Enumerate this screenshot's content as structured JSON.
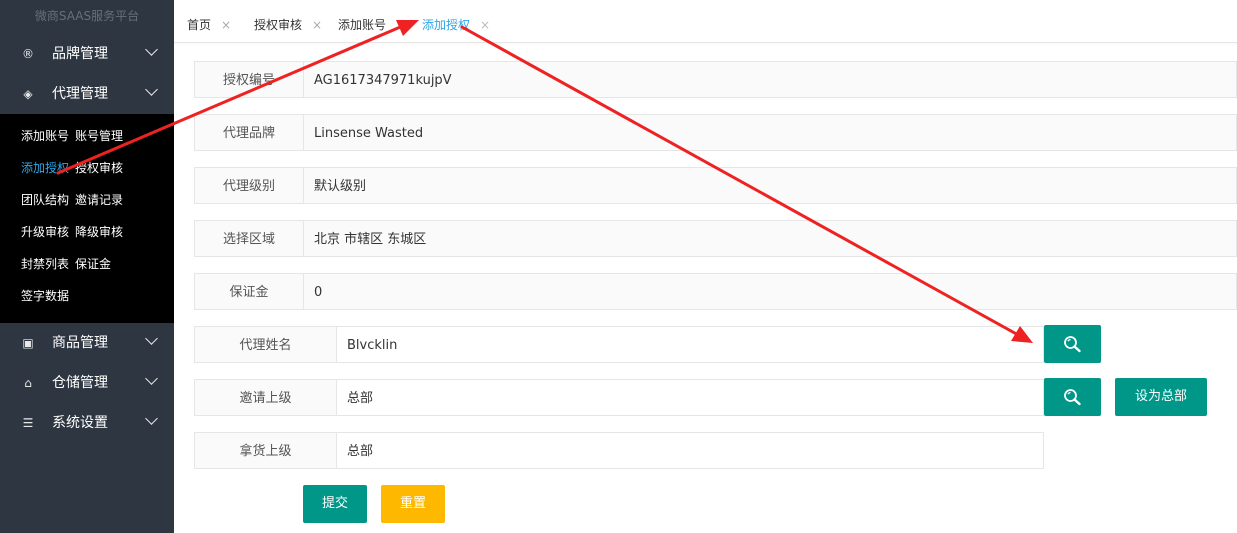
{
  "sidebar": {
    "brand": "微商SAAS服务平台",
    "menus": [
      {
        "label": "品牌管理",
        "icon": "brand-icon"
      },
      {
        "label": "代理管理",
        "icon": "agent-icon"
      },
      {
        "label": "商品管理",
        "icon": "goods-icon"
      },
      {
        "label": "仓储管理",
        "icon": "warehouse-icon"
      },
      {
        "label": "系统设置",
        "icon": "settings-icon"
      }
    ],
    "submenu": [
      [
        "添加账号",
        "账号管理"
      ],
      [
        "添加授权",
        "授权审核"
      ],
      [
        "团队结构",
        "邀请记录"
      ],
      [
        "升级审核",
        "降级审核"
      ],
      [
        "封禁列表",
        "保证金"
      ],
      [
        "签字数据"
      ]
    ],
    "active_submenu": "添加授权"
  },
  "tabs": [
    {
      "label": "首页",
      "close": "×"
    },
    {
      "label": "授权审核",
      "close": "×"
    },
    {
      "label": "添加账号",
      "close": ""
    },
    {
      "label": "添加授权",
      "close": "×"
    }
  ],
  "form": {
    "auth_no": {
      "label": "授权编号",
      "value": "AG1617347971kujpV"
    },
    "brand": {
      "label": "代理品牌",
      "value": "Linsense Wasted"
    },
    "level": {
      "label": "代理级别",
      "value": "默认级别"
    },
    "region": {
      "label": "选择区域",
      "value": "北京 市辖区 东城区"
    },
    "deposit": {
      "label": "保证金",
      "value": "0"
    },
    "agent_name": {
      "label": "代理姓名",
      "value": "Blvcklin"
    },
    "inviter": {
      "label": "邀请上级",
      "value": "总部"
    },
    "supplier": {
      "label": "拿货上级",
      "value": "总部"
    }
  },
  "buttons": {
    "set_hq": "设为总部",
    "submit": "提交",
    "reset": "重置"
  },
  "colors": {
    "sidebar_bg": "#2d3641",
    "submenu_bg": "#000000",
    "active": "#2da7e8",
    "green": "#009688",
    "yellow": "#ffb800",
    "arrow": "#ee2222"
  }
}
